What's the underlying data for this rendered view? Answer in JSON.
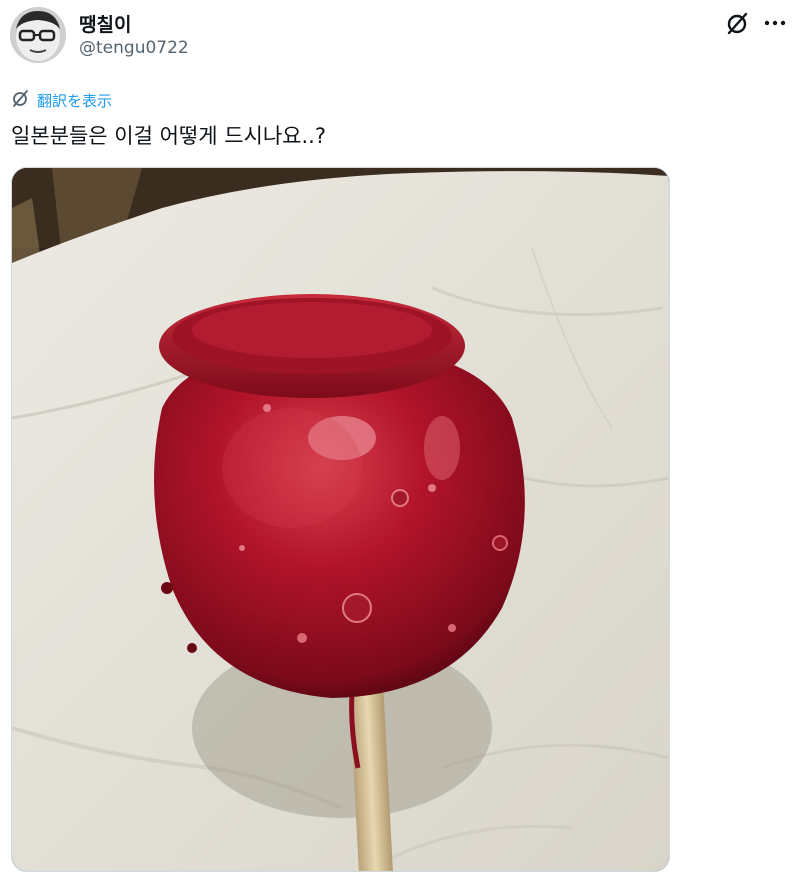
{
  "user": {
    "display_name": "땡칠이",
    "handle": "@tengu0722"
  },
  "tweet": {
    "translate_label": "翻訳を表示",
    "text": "일본분들은 이걸 어떻게 드시나요..?"
  },
  "colors": {
    "link": "#1d9bf0",
    "text": "#0f1419",
    "secondary": "#536471"
  },
  "icons": [
    "avatar",
    "grok-icon",
    "more-icon",
    "translate-icon"
  ]
}
